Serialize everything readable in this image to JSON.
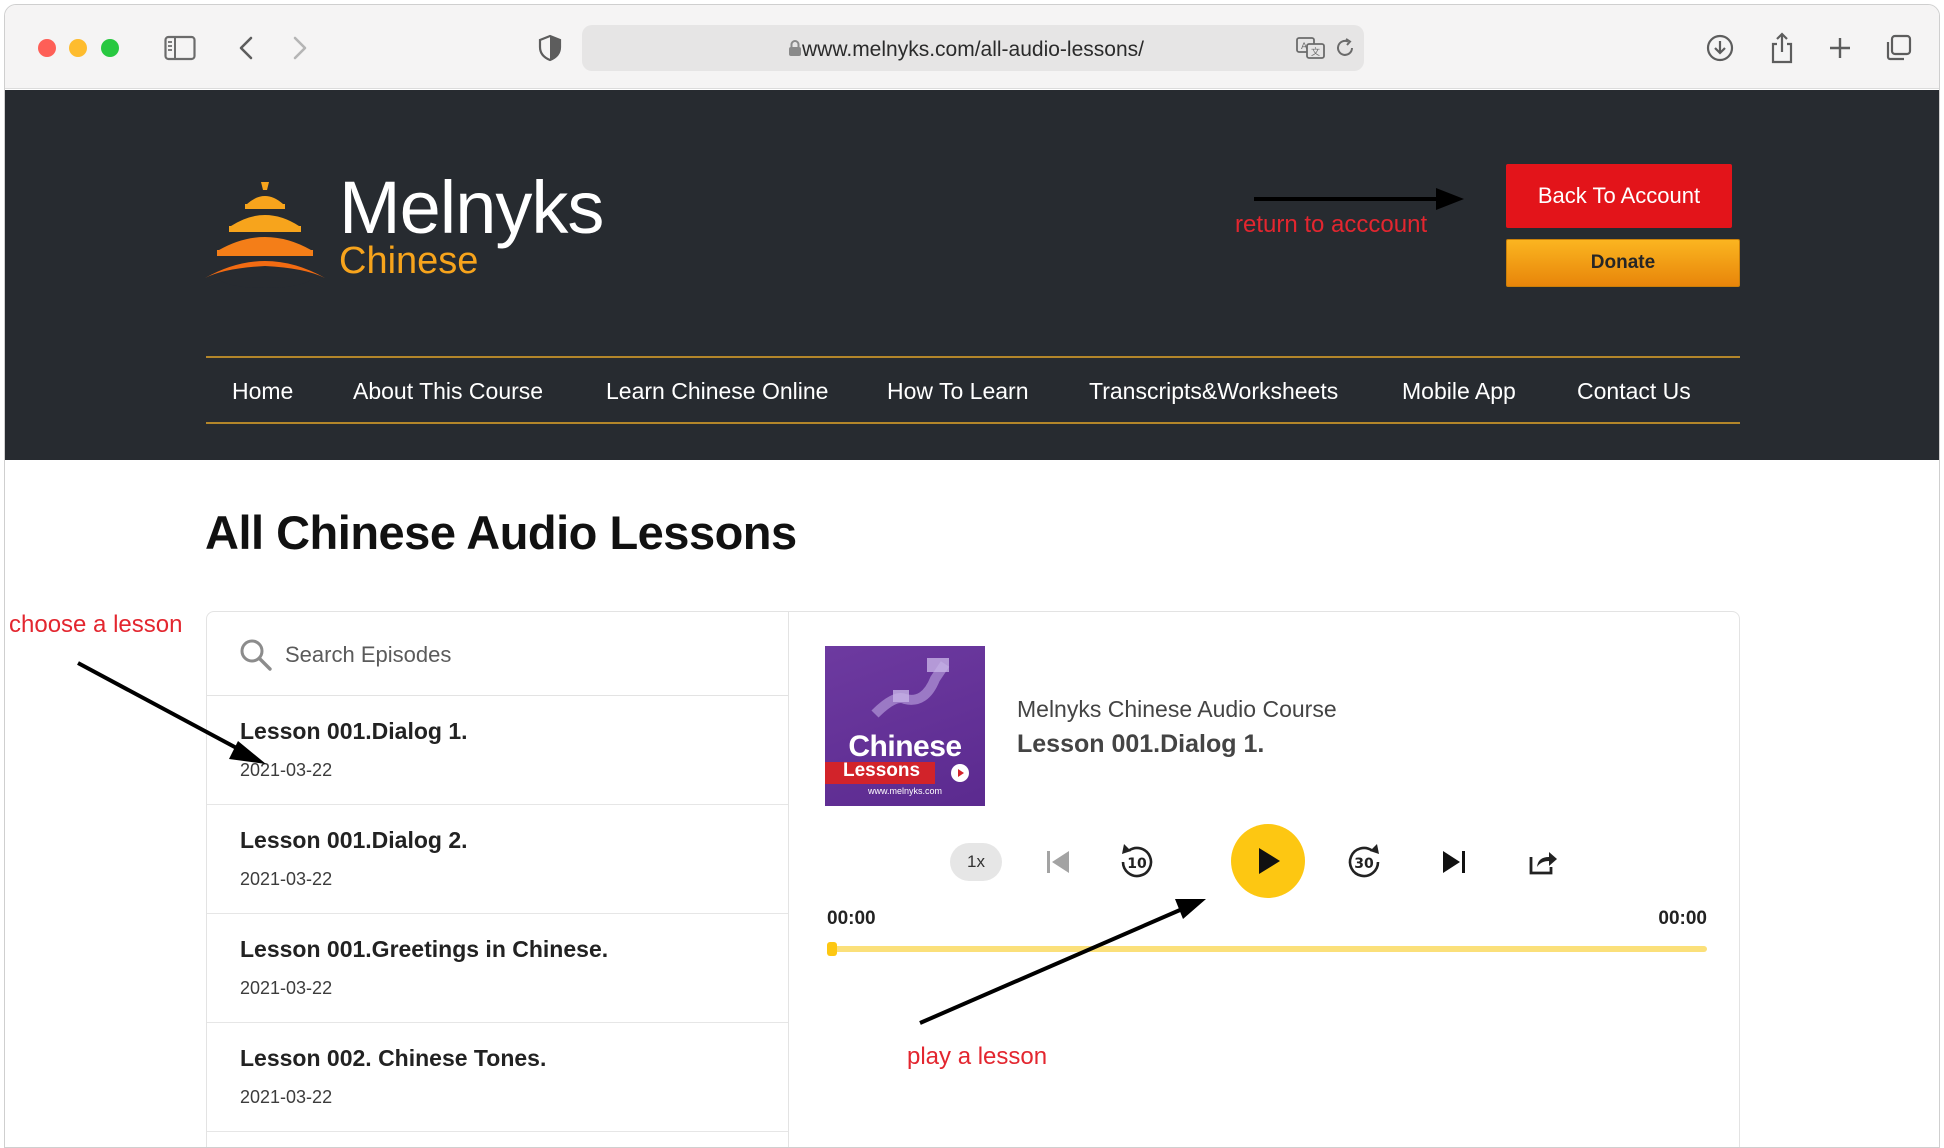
{
  "browser": {
    "url": "www.melnyks.com/all-audio-lessons/"
  },
  "site": {
    "brand_title": "Melnyks",
    "brand_sub": "Chinese",
    "back_to_account": "Back To Account",
    "donate": "Donate",
    "nav": [
      "Home",
      "About This Course",
      "Learn Chinese Online",
      "How To Learn",
      "Transcripts&Worksheets",
      "Mobile App",
      "Contact Us"
    ]
  },
  "page": {
    "title": "All Chinese Audio Lessons"
  },
  "episodes": {
    "search_placeholder": "Search Episodes",
    "items": [
      {
        "title": "Lesson 001.Dialog 1.",
        "date": "2021-03-22"
      },
      {
        "title": "Lesson 001.Dialog 2.",
        "date": "2021-03-22"
      },
      {
        "title": "Lesson 001.Greetings in Chinese.",
        "date": "2021-03-22"
      },
      {
        "title": "Lesson 002. Chinese Tones.",
        "date": "2021-03-22"
      }
    ]
  },
  "player": {
    "cover_title": "Chinese",
    "cover_sub": "Lessons",
    "cover_url": "www.melnyks.com",
    "course": "Melnyks Chinese Audio Course",
    "lesson": "Lesson 001.Dialog 1.",
    "speed": "1x",
    "rewind_seconds": "10",
    "forward_seconds": "30",
    "time_current": "00:00",
    "time_total": "00:00",
    "progress": 0
  },
  "annotations": {
    "return": "return to acccount",
    "choose": "choose a lesson",
    "play": "play a lesson"
  },
  "colors": {
    "header_bg": "#272b30",
    "accent_orange": "#f7a41c",
    "account_red": "#e3141a",
    "play_yellow": "#fdc712",
    "annotation_red": "#e3262f"
  }
}
